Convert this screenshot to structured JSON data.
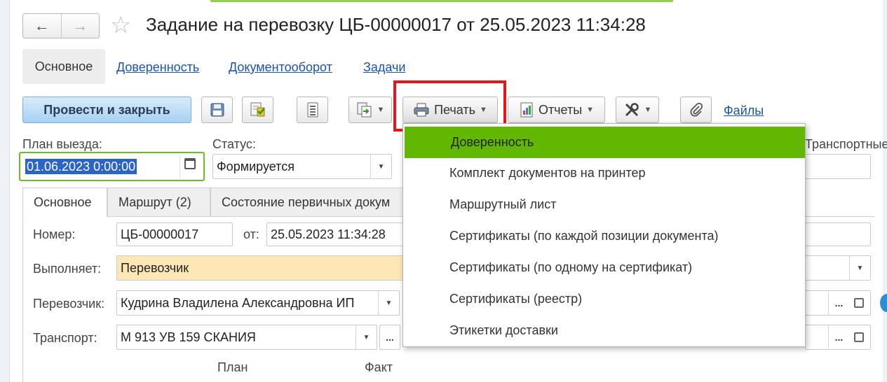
{
  "window": {
    "title": "Задание на перевозку ЦБ-00000017 от 25.05.2023 11:34:28",
    "back_icon": "←",
    "forward_icon": "→",
    "favorite_icon": "☆"
  },
  "nav_tabs": [
    {
      "label": "Основное",
      "active": true
    },
    {
      "label": "Доверенность"
    },
    {
      "label": "Документооборот"
    },
    {
      "label": "Задачи"
    }
  ],
  "toolbar": {
    "post_close_label": "Провести и закрыть",
    "print_label": "Печать",
    "reports_label": "Отчеты",
    "files_label": "Файлы",
    "icons": [
      "save-icon",
      "post-icon",
      "list-icon",
      "create-based-on-icon",
      "printer-icon",
      "report-icon",
      "tools-icon",
      "paperclip-icon"
    ]
  },
  "header_fields": {
    "plan_label": "План выезда:",
    "plan_value": "01.06.2023  0:00:00",
    "status_label": "Статус:",
    "status_value": "Формируется",
    "right_label": "Транспортные"
  },
  "form_tabs": [
    {
      "label": "Основное",
      "active": true
    },
    {
      "label": "Маршрут (2)"
    },
    {
      "label": "Состояние первичных докум"
    }
  ],
  "form": {
    "number_label": "Номер:",
    "number_value": "ЦБ-00000017",
    "from_label": "от:",
    "date_value": "25.05.2023 11:34:28",
    "performer_label": "Выполняет:",
    "performer_value": "Перевозчик",
    "carrier_label": "Перевозчик:",
    "carrier_value": "Кудрина Владилена Александровна ИП",
    "transport_label": "Транспорт:",
    "transport_value": "М 913 УВ 159 СКАНИЯ",
    "plan_col": "План",
    "fact_col": "Факт",
    "ellipsis": "..."
  },
  "print_menu": {
    "items": [
      {
        "label": "Доверенность",
        "highlighted": true
      },
      {
        "label": "Комплект документов на принтер"
      },
      {
        "label": "Маршрутный лист"
      },
      {
        "label": "Сертификаты (по каждой позиции документа)"
      },
      {
        "label": "Сертификаты (по одному на сертификат)"
      },
      {
        "label": "Сертификаты (реестр)"
      },
      {
        "label": "Этикетки доставки"
      }
    ]
  },
  "colors": {
    "accent_green": "#62b800",
    "highlight_red": "#e8141b",
    "link_blue": "#1c54a8",
    "selection_blue": "#2b63c6",
    "performer_bg": "#fde7b6"
  }
}
